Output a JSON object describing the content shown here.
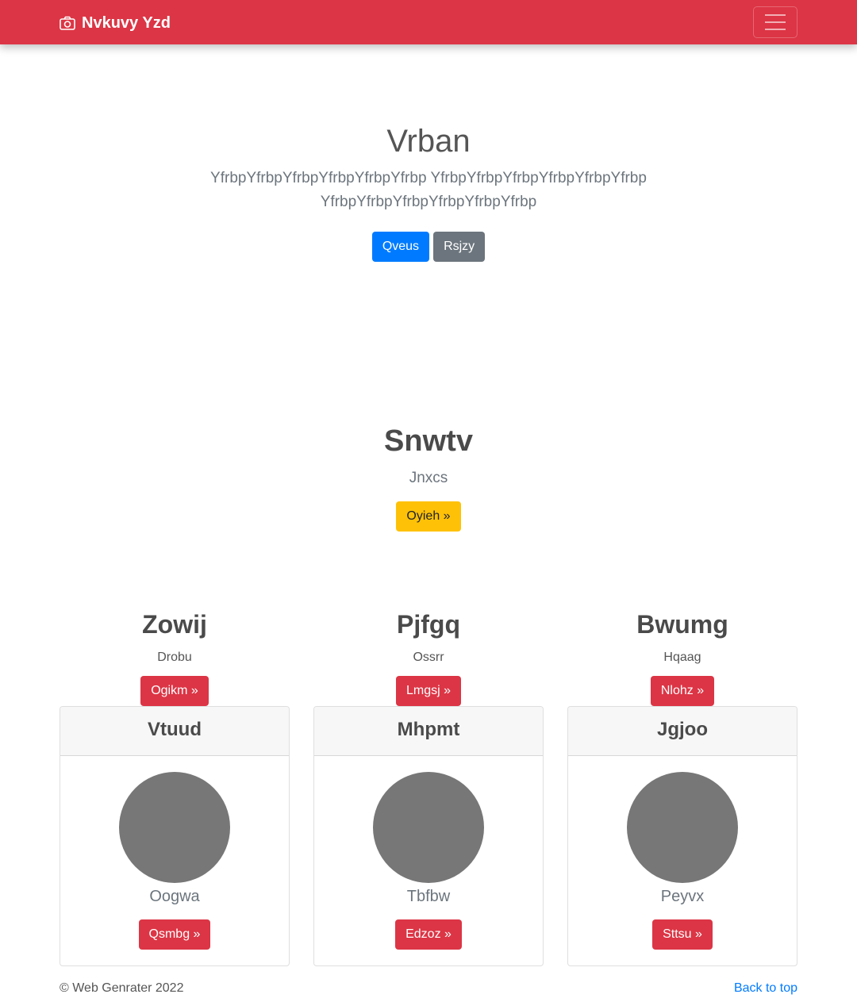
{
  "navbar": {
    "brand": "Nvkuvy Yzd",
    "brand_icon": "camera-icon",
    "toggler_icon": "hamburger-menu-icon",
    "color": "#dc3545"
  },
  "hero": {
    "title": "Vrban",
    "lead": "YfrbpYfrbpYfrbpYfrbpYfrbpYfrbp YfrbpYfrbpYfrbpYfrbpYfrbpYfrbp YfrbpYfrbpYfrbpYfrbpYfrbpYfrbp",
    "primary_button": "Qveus",
    "secondary_button": "Rsjzy"
  },
  "section": {
    "title": "Snwtv",
    "subtitle": "Jnxcs",
    "button": "Oyieh »"
  },
  "features": [
    {
      "title": "Zowij",
      "subtitle": "Drobu",
      "button": "Ogikm »"
    },
    {
      "title": "Pjfgq",
      "subtitle": "Ossrr",
      "button": "Lmgsj »"
    },
    {
      "title": "Bwumg",
      "subtitle": "Hqaag",
      "button": "Nlohz »"
    }
  ],
  "cards": [
    {
      "header": "Vtuud",
      "name": "Oogwa",
      "button": "Qsmbg »"
    },
    {
      "header": "Mhpmt",
      "name": "Tbfbw",
      "button": "Edzoz »"
    },
    {
      "header": "Jgjoo",
      "name": "Peyvx",
      "button": "Sttsu »"
    }
  ],
  "footer": {
    "copyright": "© Web Genrater 2022",
    "back_to_top": "Back to top"
  }
}
